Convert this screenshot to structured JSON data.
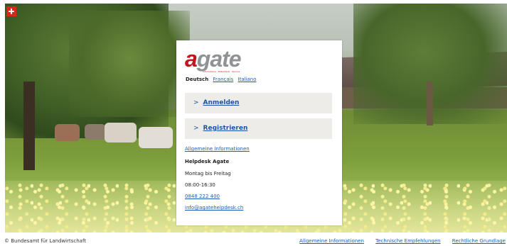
{
  "header": {
    "flag_icon": "swiss-flag-icon"
  },
  "card": {
    "logo_first": "a",
    "logo_rest": "gate",
    "logo_sub": "Informations · Datenbank · Service",
    "languages": [
      {
        "label": "Deutsch",
        "active": true
      },
      {
        "label": "Français",
        "active": false
      },
      {
        "label": "Italiano",
        "active": false
      }
    ],
    "login_label": "Anmelden",
    "register_label": "Registrieren",
    "chevron": ">",
    "info_link": "Allgemeine Informationen",
    "helpdesk": {
      "title": "Helpdesk Agate",
      "days": "Montag bis Freitag",
      "hours": "08:00-16:30",
      "phone": "0848 222 400",
      "email": "info@agatehelpdesk.ch"
    }
  },
  "footer": {
    "copyright": "© Bundesamt für Landwirtschaft",
    "links": [
      "Allgemeine Informationen",
      "Technische Empfehlungen",
      "Rechtliche Grundlage"
    ]
  },
  "colors": {
    "brand_red": "#c4141d",
    "link_blue": "#1a5eb8",
    "button_bg": "#eeece9"
  }
}
